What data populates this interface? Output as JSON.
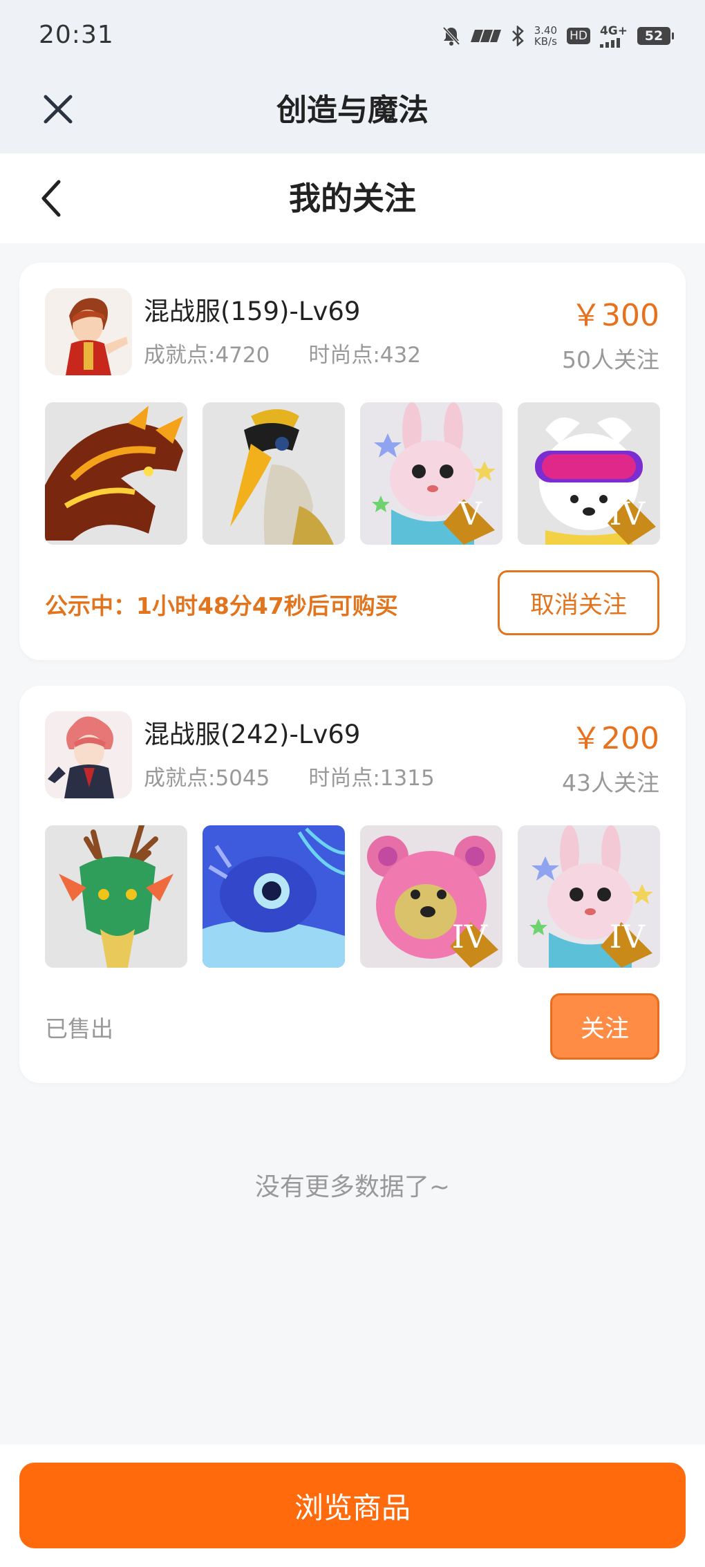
{
  "status_bar": {
    "time": "20:31",
    "net_speed_value": "3.40",
    "net_speed_unit": "KB/s",
    "hd": "HD",
    "network": "4G+",
    "battery": "52",
    "icons": [
      "mute-icon",
      "nfc-icon",
      "bluetooth-icon",
      "hd-icon",
      "signal-icon",
      "battery-icon"
    ]
  },
  "app_bar": {
    "title": "创造与魔法"
  },
  "page": {
    "title": "我的关注"
  },
  "cards": [
    {
      "server": "混战服(159)-Lv69",
      "achievement": "成就点:4720",
      "fashion": "时尚点:432",
      "price": "￥300",
      "followers": "50人关注",
      "item_grades": [
        "",
        "",
        "V",
        "IV"
      ],
      "status": "公示中：1小时48分47秒后可购买",
      "action": "取消关注"
    },
    {
      "server": "混战服(242)-Lv69",
      "achievement": "成就点:5045",
      "fashion": "时尚点:1315",
      "price": "￥200",
      "followers": "43人关注",
      "item_grades": [
        "",
        "",
        "IV",
        "IV"
      ],
      "status": "已售出",
      "action": "关注"
    }
  ],
  "list_end": "没有更多数据了~",
  "bottom": {
    "browse_label": "浏览商品"
  },
  "colors": {
    "accent": "#e3741e",
    "primary_button": "#ff6a0c",
    "follow_button": "#ff8c45"
  }
}
